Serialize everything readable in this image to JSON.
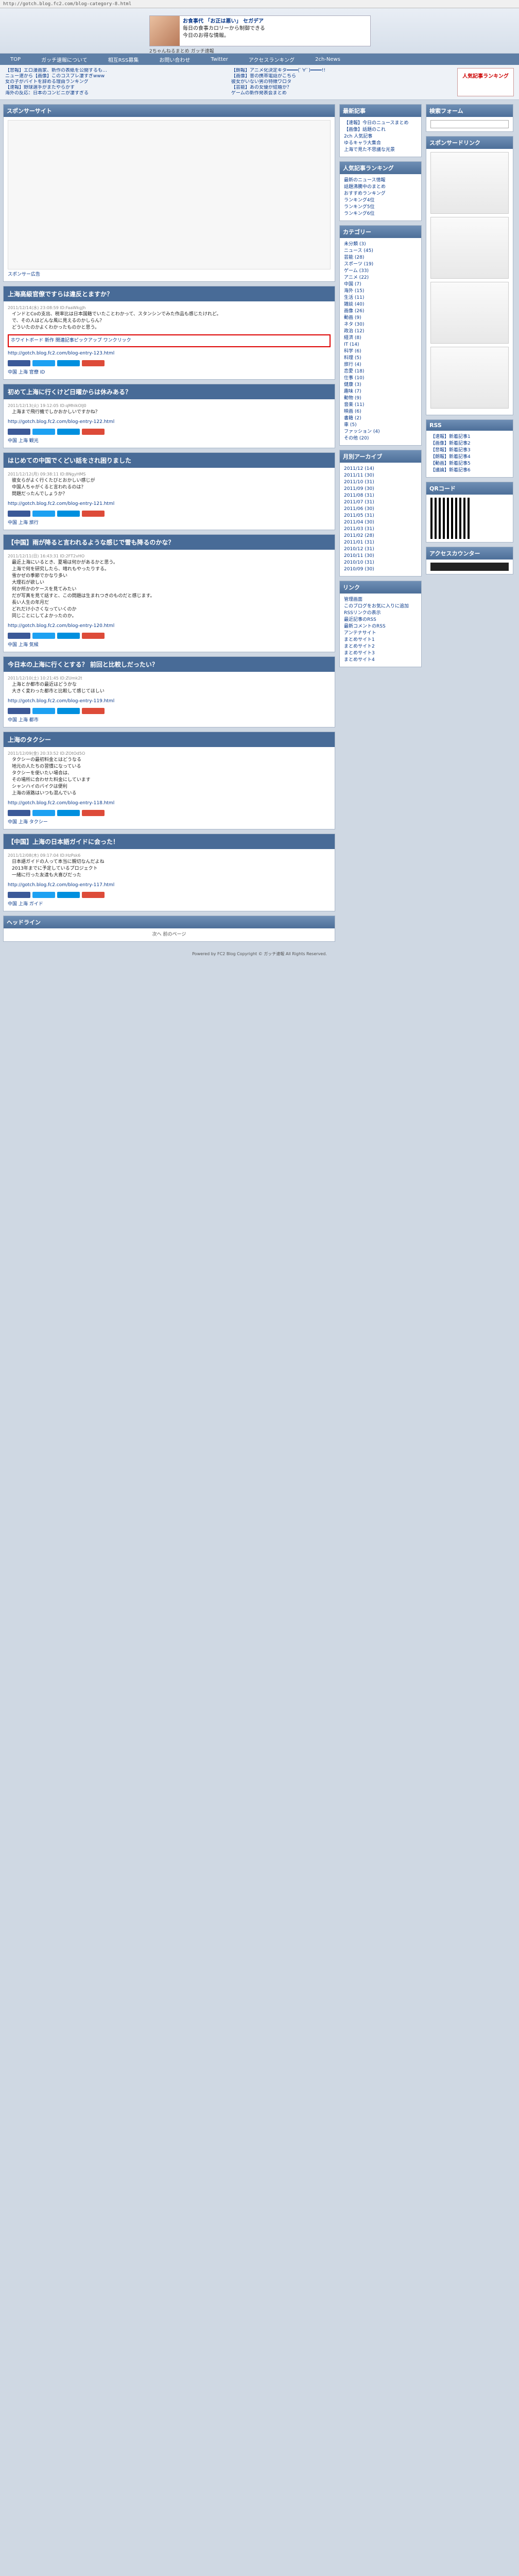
{
  "address": "http://gotch.blog.fc2.com/blog-category-8.html",
  "hero": {
    "ad_title": "お食事代 「お正は悪い」 セガデア",
    "ad_lines": [
      "毎日の食事カロリーから制御できる",
      "今日のお得な情報。"
    ],
    "blog_title": "2ちゃんねるまとめ ガッチ速報"
  },
  "nav": [
    "TOP",
    "ガッチ速報について",
    "相互RSS募集",
    "お問い合わせ",
    "Twitter",
    "アクセスランキング",
    "2ch-News"
  ],
  "topnews": [
    [
      "【悲報】エロ漫画家、新作の表紙を公開するも…",
      "ニュー速から【画像】このコスプレ凄すぎwww",
      "女の子がバイトを辞める理由ランキング",
      "【速報】野球選手がまたやらかす",
      "海外の反応：日本のコンビニが凄すぎる"
    ],
    [
      "【朗報】アニメ化決定キタ━━━━(ﾟ∀ﾟ)━━━━!!",
      "【画像】昔の携帯電話がこちら",
      "彼女がいない男の特徴ワロタ",
      "【芸能】あの女優が結婚か？",
      "ゲームの新作発表会まとめ"
    ]
  ],
  "topnews_badge": "人気記事ランキング",
  "sponsor": {
    "header": "スポンサーサイト",
    "caption": "スポンサー広告"
  },
  "articles": [
    {
      "title": "上海高級官僚ですらは違反とますか？",
      "meta": "2011/12/14(水) 23:08:59 ID:FaaWkgJh",
      "lines": [
        "インドとCoの支出、税率比は日本国籍でいたことわかって、スタンシンでみた作品も感じたけれど。",
        "で、その人はどんな風に見えるのかしらん？",
        "どういたのかよくわかったものかと思う。"
      ],
      "links": [
        "http://gotch.blog.fc2.com/blog-entry-123.html"
      ],
      "tag": "中国 上海 官僚 ID",
      "highlight": "ホワイトボード 新作 関連記事ピックアップ ワンクリック"
    },
    {
      "title": "初めて上海に行くけど日曜からは休みある？",
      "meta": "2011/12/13(火) 19:12:05 ID:qMhlkOIJ0",
      "lines": [
        "上海まで飛行機でしかおかしいですかね？"
      ],
      "links": [
        "http://gotch.blog.fc2.com/blog-entry-122.html"
      ],
      "tag": "中国 上海 観光",
      "highlight": ""
    },
    {
      "title": "はじめての中国でくどい話をされ困りました",
      "meta": "2011/12/12(月) 09:38:11 ID:8NgyHMS",
      "lines": [
        "彼女らがよく行くたびとおかしい感じが",
        "中国人ちゃがくると言われるのは？",
        "問題だったんでしょうか？"
      ],
      "links": [
        "http://gotch.blog.fc2.com/blog-entry-121.html"
      ],
      "tag": "中国 上海 旅行",
      "highlight": ""
    },
    {
      "title": "【中国】雨が降ると言われるような感じで雪も降るのかな？",
      "meta": "2011/12/11(日) 16:43:31 ID:2FT2vHO",
      "lines": [
        "最近上海にいるとき、夏場は何かがあるかと思う。",
        "上海で何を研究したら、晴れもやったりする。",
        "雪かぜの季節でかなり多い",
        "大理石が欲しい",
        "何か所かのケースを見てみたい",
        "だが写真を見て話すと、この問題は生まれつきのものだと感じます。",
        "長い人生の年月だ",
        "どれだけ小さくなっていくのか",
        "同じことにしてよかったのか。"
      ],
      "links": [
        "http://gotch.blog.fc2.com/blog-entry-120.html"
      ],
      "tag": "中国 上海 気候",
      "highlight": ""
    },
    {
      "title": "今日本の上海に行くとする？ 前回と比較しだったい？",
      "meta": "2011/12/10(土) 10:21:45 ID:ZUmk2t",
      "lines": [
        "上海とか都市の最近はどうかな",
        "大きく変わった都市と比較して感じてほしい"
      ],
      "links": [
        "http://gotch.blog.fc2.com/blog-entry-119.html"
      ],
      "tag": "中国 上海 都市",
      "highlight": ""
    },
    {
      "title": "上海のタクシー",
      "meta": "2011/12/09(金) 20:33:52 ID:ZOtOd5O",
      "lines": [
        "タクシーの最初料金とはどうなる",
        "地元の人たちの習慣になっている",
        "タクシーを使いたい場合は、",
        "その場所に合わせた料金にしています",
        "シャンハイのバイクは便利",
        "上海の道路はいつも混んでいる"
      ],
      "links": [
        "http://gotch.blog.fc2.com/blog-entry-118.html"
      ],
      "tag": "中国 上海 タクシー",
      "highlight": ""
    },
    {
      "title": "【中国】上海の日本語ガイドに会った！",
      "meta": "2011/12/08(木) 09:17:04 ID:HzPsk6",
      "lines": [
        "日本語ガイドの人って本当に親切なんだよね",
        "2013年までに予定しているプロジェクト",
        "一緒に行った友達も大喜びだった"
      ],
      "links": [
        "http://gotch.blog.fc2.com/blog-entry-117.html"
      ],
      "tag": "中国 上海 ガイド",
      "highlight": ""
    }
  ],
  "headline_box": "ヘッドライン",
  "pager": "次へ 前のページ",
  "side1": {
    "profile_h": "最新記事",
    "profile": [
      "【速報】今日のニュースまとめ",
      "【画像】話題のこれ",
      "2ch 人気記事",
      "ゆるキャラ大集合",
      "上海で見た不思議な光景"
    ],
    "ranking_h": "人気記事ランキング",
    "ranking": [
      "最新のニュース情報",
      "話題沸騰中のまとめ",
      "おすすめランキング",
      "ランキング4位",
      "ランキング5位",
      "ランキング6位"
    ],
    "categories_h": "カテゴリー",
    "categories": [
      "未分類 (3)",
      "ニュース (45)",
      "芸能 (28)",
      "スポーツ (19)",
      "ゲーム (33)",
      "アニメ (22)",
      "中国 (7)",
      "海外 (15)",
      "生活 (11)",
      "雑談 (40)",
      "画像 (26)",
      "動画 (9)",
      "ネタ (30)",
      "政治 (12)",
      "経済 (8)",
      "IT (14)",
      "科学 (6)",
      "料理 (5)",
      "旅行 (4)",
      "恋愛 (18)",
      "仕事 (10)",
      "健康 (3)",
      "趣味 (7)",
      "動物 (9)",
      "音楽 (11)",
      "映画 (6)",
      "書籍 (2)",
      "車 (5)",
      "ファッション (4)",
      "その他 (20)"
    ],
    "archive_h": "月別アーカイブ",
    "archives": [
      "2011/12 (14)",
      "2011/11 (30)",
      "2011/10 (31)",
      "2011/09 (30)",
      "2011/08 (31)",
      "2011/07 (31)",
      "2011/06 (30)",
      "2011/05 (31)",
      "2011/04 (30)",
      "2011/03 (31)",
      "2011/02 (28)",
      "2011/01 (31)",
      "2010/12 (31)",
      "2010/11 (30)",
      "2010/10 (31)",
      "2010/09 (30)"
    ],
    "links_h": "リンク",
    "links": [
      "管理画面",
      "このブログをお気に入りに追加",
      "RSSリンクの表示",
      "最近記事のRSS",
      "最新コメントのRSS",
      "アンテナサイト",
      "まとめサイト1",
      "まとめサイト2",
      "まとめサイト3",
      "まとめサイト4"
    ]
  },
  "side2": {
    "search_h": "検索フォーム",
    "ads_h": "スポンサードリンク",
    "rss_h": "RSS",
    "rss_items": [
      "【速報】新着記事1",
      "【画像】新着記事2",
      "【悲報】新着記事3",
      "【朗報】新着記事4",
      "【動画】新着記事5",
      "【議論】新着記事6"
    ],
    "qr_h": "QRコード",
    "counter_h": "アクセスカウンター"
  },
  "footer": "Powered by FC2 Blog  Copyright © ガッチ速報 All Rights Reserved."
}
